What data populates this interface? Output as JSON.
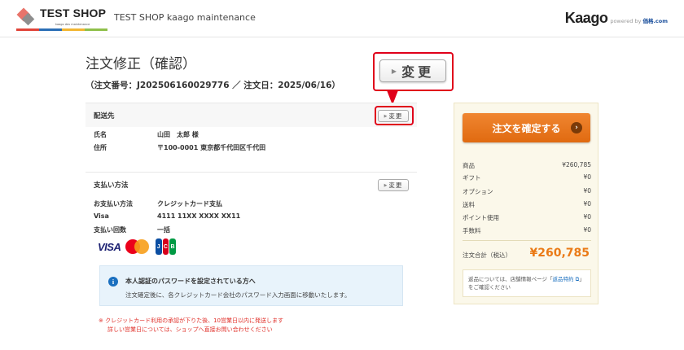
{
  "header": {
    "logo_text": "TEST SHOP",
    "logo_sub": "kaago dev maintenance",
    "shop_title": "TEST SHOP kaago maintenance",
    "brand": "Kaago",
    "powered_by": "powered by",
    "powered_site": "価格.com"
  },
  "page": {
    "title": "注文修正（確認）",
    "order_info": "（注文番号：J202506160029776 ／ 注文日：2025/06/16）"
  },
  "callout": {
    "label": "変更"
  },
  "shipping": {
    "title": "配送先",
    "change_label": "変更",
    "rows": [
      {
        "label": "氏名",
        "value": "山田　太郎 様"
      },
      {
        "label": "住所",
        "value": "〒100-0001 東京都千代田区千代田"
      }
    ]
  },
  "payment": {
    "title": "支払い方法",
    "change_label": "変更",
    "rows": [
      {
        "label": "お支払い方法",
        "value": "クレジットカード支払"
      },
      {
        "label": "Visa",
        "value": "4111 11XX XXXX XX11"
      },
      {
        "label": "支払い回数",
        "value": "一括"
      }
    ],
    "cards": {
      "visa": "VISA",
      "jcb": [
        "J",
        "C",
        "B"
      ]
    }
  },
  "info": {
    "title": "本人認証のパスワードを設定されている方へ",
    "text": "注文確定後に、各クレジットカード会社のパスワード入力画面に移動いたします。"
  },
  "notes": [
    "※ クレジットカード利用の承認が下りた後、10営業日以内に発送します",
    "詳しい営業日については、ショップへ直接お問い合わせください"
  ],
  "sidebar": {
    "confirm_label": "注文を確定する",
    "summary": [
      {
        "label": "商品",
        "value": "¥260,785"
      },
      {
        "label": "ギフト",
        "value": "¥0"
      },
      {
        "label": "オプション",
        "value": "¥0"
      },
      {
        "label": "送料",
        "value": "¥0"
      },
      {
        "label": "ポイント使用",
        "value": "¥0"
      },
      {
        "label": "手数料",
        "value": "¥0"
      }
    ],
    "total_label": "注文合計（税込）",
    "total_value": "¥260,785",
    "return_text_1": "返品については、店舗情報ページ「",
    "return_link": "返品特約",
    "return_text_2": "」をご確認ください"
  },
  "colors": {
    "accent_orange": "#ea7a16",
    "highlight_red": "#e0001a",
    "info_blue": "#1a6fbf"
  }
}
